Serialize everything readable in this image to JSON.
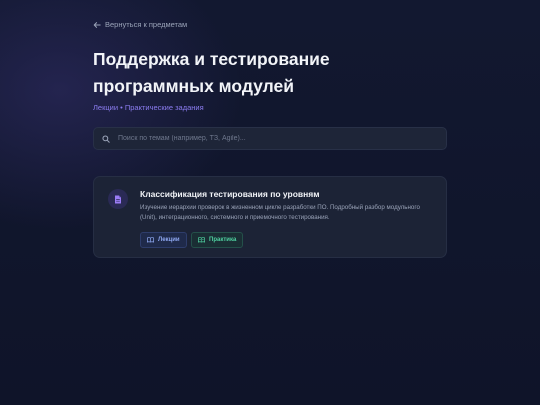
{
  "nav": {
    "back_label": "Вернуться к предметам"
  },
  "page": {
    "title": "Поддержка и тестирование программных модулей",
    "subtitle": "Лекции • Практические задания"
  },
  "search": {
    "placeholder": "Поиск по темам (например, ТЗ, Agile)..."
  },
  "topics": [
    {
      "icon": "document-icon",
      "title": "Классификация тестирования по уровням",
      "description": "Изучение иерархии проверок в жизненном цикле разработки ПО. Подробный разбор модульного (Unit), интеграционного, системного и приемочного тестирования.",
      "lecture_label": "Лекции",
      "practice_label": "Практика"
    }
  ],
  "colors": {
    "accent": "#8b7cf0",
    "lecture": "#8ea7f0",
    "practice": "#4fd1a0",
    "background": "#111731",
    "card": "#1c2336"
  }
}
